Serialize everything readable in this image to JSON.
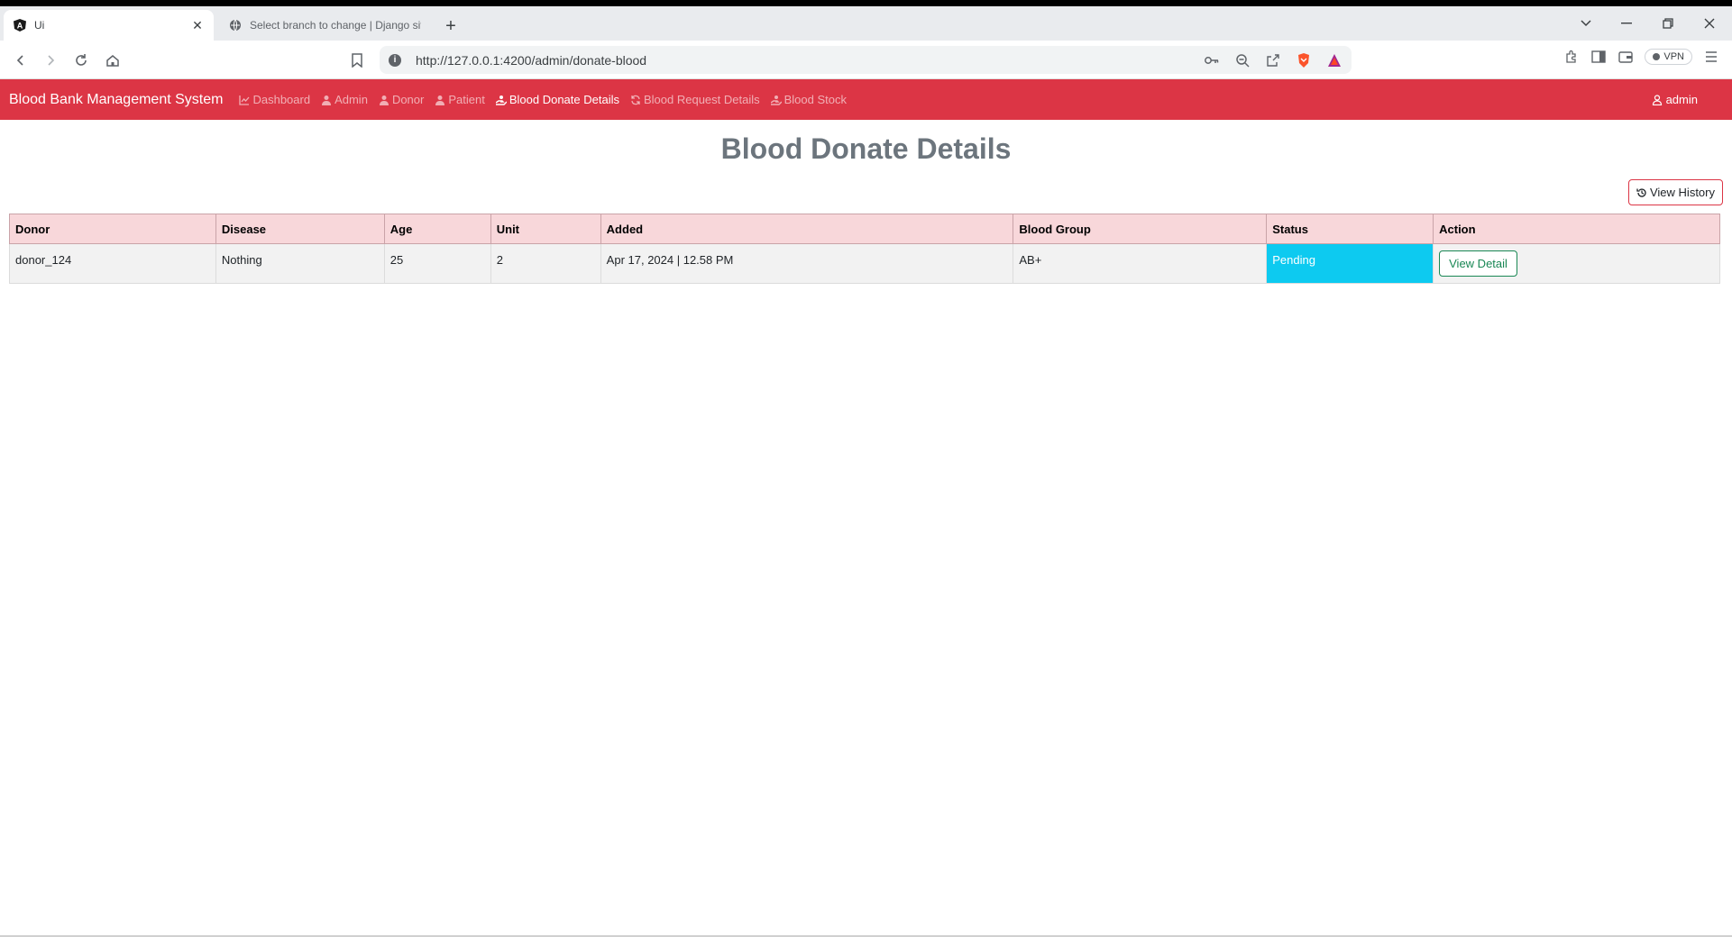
{
  "browser": {
    "tabs": [
      {
        "title": "Ui",
        "active": true
      },
      {
        "title": "Select branch to change | Django site",
        "active": false
      }
    ],
    "url": "http://127.0.0.1:4200/admin/donate-blood",
    "vpn_label": "VPN"
  },
  "navbar": {
    "brand": "Blood Bank Management System",
    "links": [
      {
        "label": "Dashboard",
        "icon": "chart-line-icon"
      },
      {
        "label": "Admin",
        "icon": "user-icon"
      },
      {
        "label": "Donor",
        "icon": "user-icon"
      },
      {
        "label": "Patient",
        "icon": "user-icon"
      },
      {
        "label": "Blood Donate Details",
        "icon": "hand-holding-icon",
        "active": true
      },
      {
        "label": "Blood Request Details",
        "icon": "sync-icon"
      },
      {
        "label": "Blood Stock",
        "icon": "hand-holding-icon"
      }
    ],
    "user": "admin"
  },
  "page": {
    "title": "Blood Donate Details",
    "view_history_label": "View History"
  },
  "table": {
    "headers": [
      "Donor",
      "Disease",
      "Age",
      "Unit",
      "Added",
      "Blood Group",
      "Status",
      "Action"
    ],
    "rows": [
      {
        "donor": "donor_124",
        "disease": "Nothing",
        "age": "25",
        "unit": "2",
        "added": "Apr 17, 2024 | 12.58 PM",
        "blood_group": "AB+",
        "status": "Pending",
        "action": "View Detail"
      }
    ]
  },
  "colors": {
    "navbar": "#dc3545",
    "header_row": "#f8d7da",
    "status_pending": "#0dcaf0",
    "detail_button": "#198754"
  }
}
